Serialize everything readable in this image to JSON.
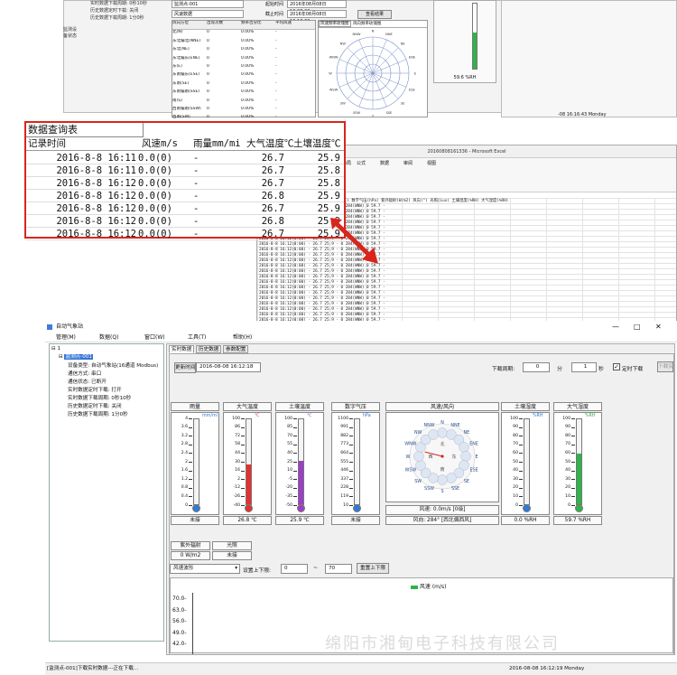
{
  "top": {
    "tree_lines": [
      "实时数据下载周期: 0秒10秒",
      "历史数据定时下载: 关闭",
      "历史数据下载周期: 1分0秒"
    ],
    "station_field": "监测点-001",
    "start_label": "起始时间",
    "start_value": "2016年08月08日 16:08:00",
    "end_label": "截止时间",
    "end_value": "2016年08月08日 16:18:00",
    "query_button": "查看结果",
    "mode_field": "风速数据",
    "stats_headers": [
      "风向方位",
      "出现次数",
      "频率百分比",
      "平均风速"
    ],
    "stats_rows": [
      [
        "北(N)",
        "0",
        "0.00%",
        "-"
      ],
      [
        "东北偏北(NNE)",
        "0",
        "0.00%",
        "-"
      ],
      [
        "东北(NE)",
        "0",
        "0.00%",
        "-"
      ],
      [
        "东北偏东(ENE)",
        "0",
        "0.00%",
        "-"
      ],
      [
        "东(E)",
        "0",
        "0.00%",
        "-"
      ],
      [
        "东南偏东(ESE)",
        "0",
        "0.00%",
        "-"
      ],
      [
        "东南(SE)",
        "0",
        "0.00%",
        "-"
      ],
      [
        "东南偏南(SSE)",
        "0",
        "0.00%",
        "-"
      ],
      [
        "南(S)",
        "0",
        "0.00%",
        "-"
      ],
      [
        "西南偏南(SSW)",
        "0",
        "0.00%",
        "-"
      ],
      [
        "西南(SW)",
        "0",
        "0.00%",
        "-"
      ],
      [
        "西南偏西(WSW)",
        "0",
        "0.00%",
        "-"
      ],
      [
        "西(W)",
        "0",
        "0.00%",
        "-"
      ],
      [
        "西北偏西(WNW)",
        "252",
        "100.00%",
        "0.00m/s"
      ],
      [
        "西北(NW)",
        "0",
        "0.00%",
        "-"
      ],
      [
        "西北偏北(NNW)",
        "0",
        "0.00%",
        "-"
      ],
      [
        "静风",
        "0",
        "0.00%",
        "-"
      ],
      [
        "总计",
        "252",
        "100.00%",
        "0.00m/s"
      ]
    ],
    "rose_tabs": [
      "风速频率玫瑰图",
      "风向频率玫瑰图"
    ],
    "rose_labels": [
      "N",
      "NNE",
      "NE",
      "ENE",
      "E",
      "ESE",
      "SE",
      "SSE",
      "S",
      "SSW",
      "SW",
      "WSW",
      "W",
      "WNW",
      "NW",
      "NNW"
    ],
    "gauge_value": "59.6 %RH",
    "right_status": "-08 16:16:43 Monday",
    "left_small": [
      "监测设",
      "备状态"
    ]
  },
  "zoom": {
    "title": "数据查询表",
    "headers": [
      "记录时间",
      "风速m/s",
      "雨量mm/mi",
      "大气温度℃",
      "土壤温度℃"
    ],
    "rows": [
      [
        "2016-8-8 16:11",
        "0.0(0)",
        "-",
        "26.7",
        "25.9"
      ],
      [
        "2016-8-8 16:11",
        "0.0(0)",
        "-",
        "26.7",
        "25.8"
      ],
      [
        "2016-8-8 16:12",
        "0.0(0)",
        "-",
        "26.7",
        "25.8"
      ],
      [
        "2016-8-8 16:12",
        "0.0(0)",
        "-",
        "26.8",
        "25.9"
      ],
      [
        "2016-8-8 16:12",
        "0.0(0)",
        "-",
        "26.7",
        "25.9"
      ],
      [
        "2016-8-8 16:12",
        "0.0(0)",
        "-",
        "26.8",
        "25.9"
      ],
      [
        "2016-8-8 16:12",
        "0.0(0)",
        "-",
        "26.7",
        "25.9"
      ]
    ]
  },
  "excel": {
    "title": "20160808161336 - Microsoft Excel",
    "ribbon_tabs": [
      "文件",
      "开始",
      "插入",
      "页面布局",
      "公式",
      "数据",
      "审阅",
      "视图"
    ],
    "header_line": "记录时间  风速(m/s) 大气温度(℃) 土壤温度(℃) 数字气压(hPa) 紫外辐射(W/m2) 风向(°) 光照(Lux) 土壤湿度(%RH) 大气湿度(%RH)",
    "row_template": "2016-8-8 16:12(0:00)  -   26.7   25.9  -   0  284(WNW)   0    59.7  -",
    "row_count": 40
  },
  "app": {
    "title": "自动气象站",
    "window_controls": [
      "—",
      "□",
      "✕"
    ],
    "menu": [
      "管理(M)",
      "数据(Q)",
      "窗口(W)",
      "工具(T)",
      "帮助(H)"
    ],
    "tree": {
      "root": "1",
      "node": "监测点-001",
      "items": [
        "设备类型: 自动气象站(16通道 Modbus)",
        "通信方式: 串口",
        "通信状态: 已断开",
        "实时数据定时下载: 打开",
        "实时数据下载周期: 0秒10秒",
        "历史数据定时下载: 关闭",
        "历史数据下载周期: 1分0秒"
      ]
    },
    "tabs": [
      "实时数据",
      "历史数据",
      "参数配置"
    ],
    "update_label": "更新时间",
    "update_value": "2016-08-08 16:12:18",
    "period_label": "下载周期:",
    "period_min": "0",
    "unit_min": "分",
    "period_sec": "1",
    "unit_sec": "秒",
    "timer_check": "定时下载",
    "download_button": "下载实时数据",
    "panels": [
      {
        "title": "雨量",
        "unit": "mm/mi",
        "ticks": [
          "4",
          "3.6",
          "3.2",
          "2.8",
          "2.4",
          "2",
          "1.6",
          "1.2",
          "0.8",
          "0.4",
          "0"
        ],
        "value": "未接",
        "level": 0,
        "color": "#2e7bd8"
      },
      {
        "title": "大气温度",
        "unit": "℃",
        "ticks": [
          "100",
          "86",
          "72",
          "58",
          "44",
          "30",
          "16",
          "2",
          "-12",
          "-26",
          "-40"
        ],
        "value": "26.8 ℃",
        "level": 0.47,
        "color": "#e53030"
      },
      {
        "title": "土壤温度",
        "unit": "℃",
        "ticks": [
          "100",
          "85",
          "70",
          "55",
          "40",
          "25",
          "10",
          "-5",
          "-20",
          "-35",
          "-50"
        ],
        "value": "25.9 ℃",
        "level": 0.51,
        "color": "#9b3fc6"
      },
      {
        "title": "数字气压",
        "unit": "hPa",
        "ticks": [
          "1100",
          "991",
          "882",
          "773",
          "664",
          "555",
          "446",
          "337",
          "228",
          "119",
          "10"
        ],
        "value": "未接",
        "level": 0,
        "color": "#2e7bd8"
      },
      {
        "title": "土壤湿度",
        "unit": "%RH",
        "ticks": [
          "100",
          "90",
          "80",
          "70",
          "60",
          "50",
          "40",
          "30",
          "20",
          "10",
          "0"
        ],
        "value": "0.0 %RH",
        "level": 0,
        "color": "#2e7bd8"
      },
      {
        "title": "大气湿度",
        "unit": "%RH",
        "ticks": [
          "100",
          "90",
          "80",
          "70",
          "60",
          "50",
          "40",
          "30",
          "20",
          "10",
          "0"
        ],
        "value": "59.7 %RH",
        "level": 0.597,
        "color": "#2fb34a"
      }
    ],
    "wind": {
      "title": "风速/风向",
      "directions": [
        "N",
        "NNE",
        "NE",
        "ENE",
        "E",
        "ESE",
        "SE",
        "SSE",
        "S",
        "SSW",
        "SW",
        "WSW",
        "W",
        "WNW",
        "NW",
        "NNW"
      ],
      "cardinal_cn": [
        "北",
        "东",
        "南",
        "西"
      ],
      "speed_line": "风速: 0.0m/s [0级]",
      "dir_line": "风向: 284° [西北偏西风]",
      "direction_deg": 284
    },
    "small_panels": [
      {
        "title": "紫外辐射",
        "value": "0 W/m2"
      },
      {
        "title": "光照",
        "value": "未接"
      }
    ],
    "chart_select": "风速波形",
    "range_label": "设置上下限:",
    "range_low": "0",
    "range_sep": "~",
    "range_high": "70",
    "range_button": "重置上下限",
    "chart_legend": "风速 (m/s)",
    "chart_ticks": [
      "70.0",
      "63.0",
      "56.0",
      "49.0",
      "42.0"
    ],
    "status_left": "[监测点-001]下载实时数据---正在下载...",
    "status_right": "2016-08-08 16:12:19 Monday",
    "watermark": "绵阳市湘甸电子科技有限公司"
  },
  "colors": {
    "red_box": "#d9251c",
    "selection": "#3875d7",
    "legend_green": "#2fb34a"
  }
}
